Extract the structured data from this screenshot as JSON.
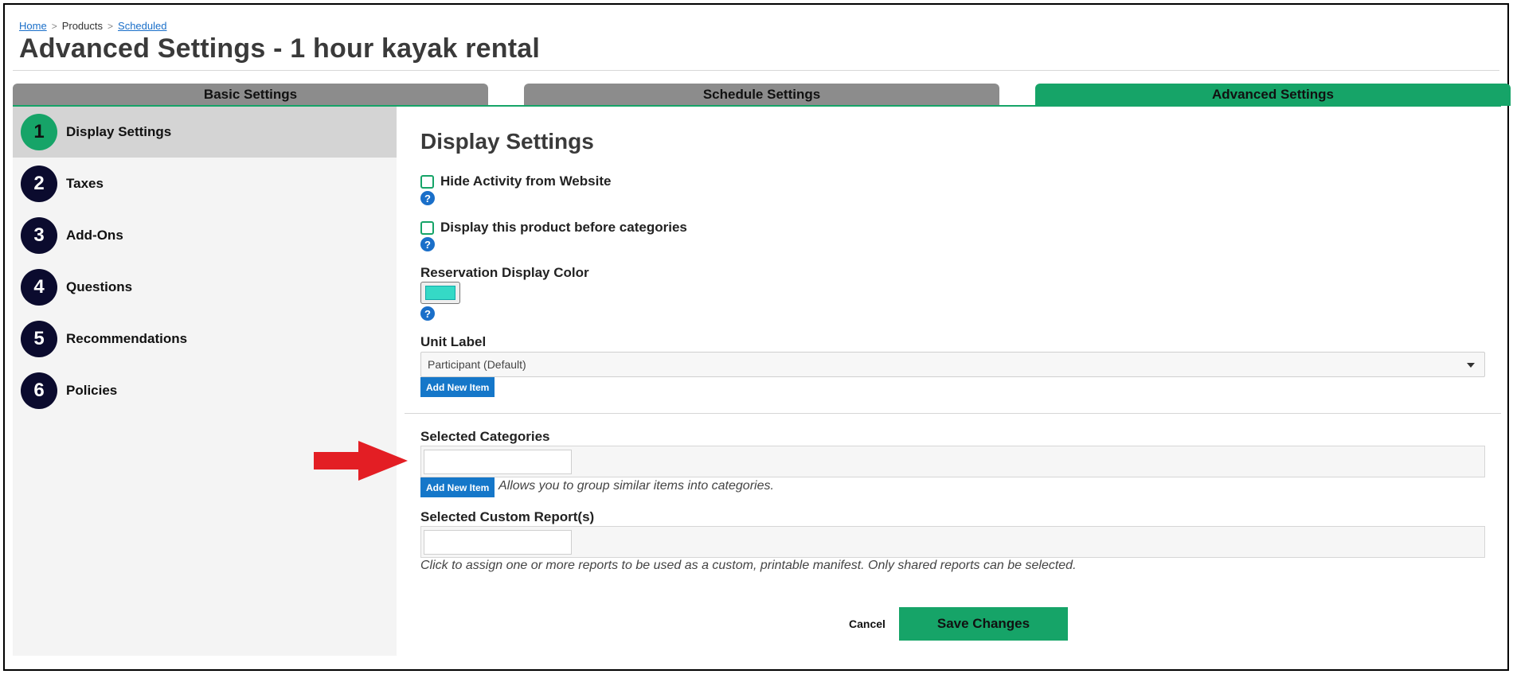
{
  "breadcrumb": {
    "home": "Home",
    "products": "Products",
    "scheduled": "Scheduled",
    "separator": ">"
  },
  "page_title": "Advanced Settings - 1 hour kayak rental",
  "tabs": [
    {
      "label": "Basic Settings"
    },
    {
      "label": "Schedule Settings"
    },
    {
      "label": "Advanced Settings"
    }
  ],
  "sidebar": {
    "items": [
      {
        "number": "1",
        "label": "Display Settings"
      },
      {
        "number": "2",
        "label": "Taxes"
      },
      {
        "number": "3",
        "label": "Add-Ons"
      },
      {
        "number": "4",
        "label": "Questions"
      },
      {
        "number": "5",
        "label": "Recommendations"
      },
      {
        "number": "6",
        "label": "Policies"
      }
    ]
  },
  "main": {
    "section_title": "Display Settings",
    "hide_activity_label": "Hide Activity from Website",
    "display_before_label": "Display this product before categories",
    "help_glyph": "?",
    "reservation_color_label": "Reservation Display Color",
    "reservation_color_value": "#35d9c6",
    "unit_label": "Unit Label",
    "unit_label_value": "Participant (Default)",
    "add_new_item": "Add New Item",
    "selected_categories_label": "Selected Categories",
    "categories_hint": "Allows you to group similar items into categories.",
    "custom_reports_label": "Selected Custom Report(s)",
    "custom_reports_hint": "Click to assign one or more reports to be used as a custom, printable manifest. Only shared reports can be selected.",
    "cancel_label": "Cancel",
    "save_label": "Save Changes"
  },
  "colors": {
    "accent_green": "#16a468",
    "tab_inactive": "#8c8c8c",
    "step_circle": "#0b0b2e",
    "link_blue": "#1a6fc9",
    "arrow_red": "#e31e24"
  }
}
